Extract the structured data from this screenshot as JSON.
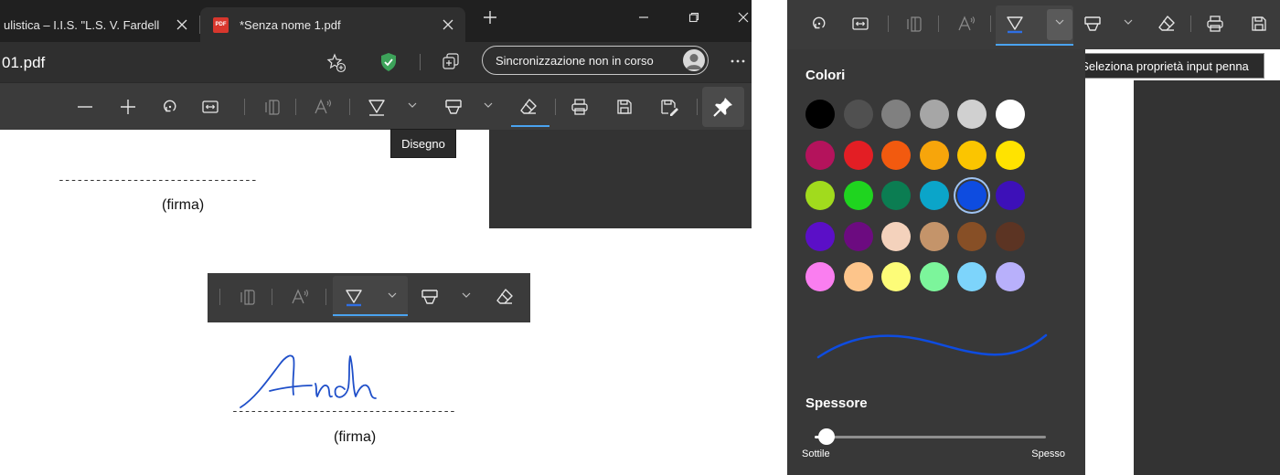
{
  "browser": {
    "tabs": [
      {
        "title": "ulistica – I.I.S. \"L.S. V. Fardell"
      },
      {
        "title": "*Senza nome 1.pdf",
        "favicon_text": "PDF"
      }
    ],
    "address": "01.pdf",
    "sync_label": "Sincronizzazione non in corso"
  },
  "pdf_toolbar": {
    "tooltip": "Disegno",
    "accent_color": "#4aa3f0"
  },
  "document": {
    "signature_line": "--------------------------------",
    "signature_label": "(firma)",
    "signature_line_2": "------------------------------------",
    "signature_label_2": "(firma)",
    "ink_color": "#1f4fc9"
  },
  "pen_panel": {
    "tooltip": "Seleziona proprietà input penna",
    "colors_title": "Colori",
    "colors": [
      [
        "#000000",
        "#505050",
        "#808080",
        "#a6a6a6",
        "#d0d0d0",
        "#ffffff"
      ],
      [
        "#b4135c",
        "#e31e24",
        "#f25a0f",
        "#f7a50b",
        "#fbc500",
        "#ffe300"
      ],
      [
        "#a1db1d",
        "#1fd41f",
        "#0b7d52",
        "#0ba5c9",
        "#0e4ce0",
        "#3d10b8"
      ],
      [
        "#5b0fc7",
        "#6c0b80",
        "#f4d2bc",
        "#c4946a",
        "#874f26",
        "#5c3423"
      ],
      [
        "#fa7ef0",
        "#fdc58b",
        "#fdfc78",
        "#7cf59b",
        "#7dd4fb",
        "#b8b0fb"
      ]
    ],
    "selected_color": "#0e4ce0",
    "thickness_title": "Spessore",
    "thickness_min_label": "Sottile",
    "thickness_max_label": "Spesso",
    "thickness_value": 0.05
  }
}
